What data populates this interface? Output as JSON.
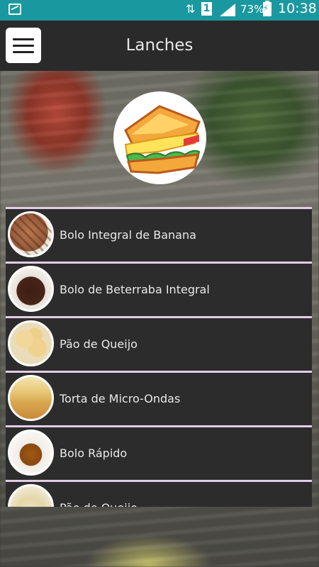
{
  "status_bar": {
    "battery": "73%",
    "time": "10:38",
    "sim_label": "1"
  },
  "app_bar": {
    "title": "Lanches"
  },
  "category": {
    "icon": "sandwich-icon"
  },
  "items": [
    {
      "label": "Bolo Integral de Banana",
      "icon": "banana-cake-thumb"
    },
    {
      "label": "Bolo de Beterraba Integral",
      "icon": "beet-cake-thumb"
    },
    {
      "label": "Pão de Queijo",
      "icon": "cheese-bread-thumb"
    },
    {
      "label": "Torta de Micro-Ondas",
      "icon": "microwave-pie-thumb"
    },
    {
      "label": "Bolo Rápido",
      "icon": "quick-cake-thumb"
    },
    {
      "label": "Pão de Queijo",
      "icon": "cheese-bread-thumb-2"
    }
  ],
  "colors": {
    "status_bar": "#1a98a0",
    "app_bar": "#2a2a2a",
    "row_bg": "#2c2c2c",
    "row_divider": "#e3cde6"
  }
}
